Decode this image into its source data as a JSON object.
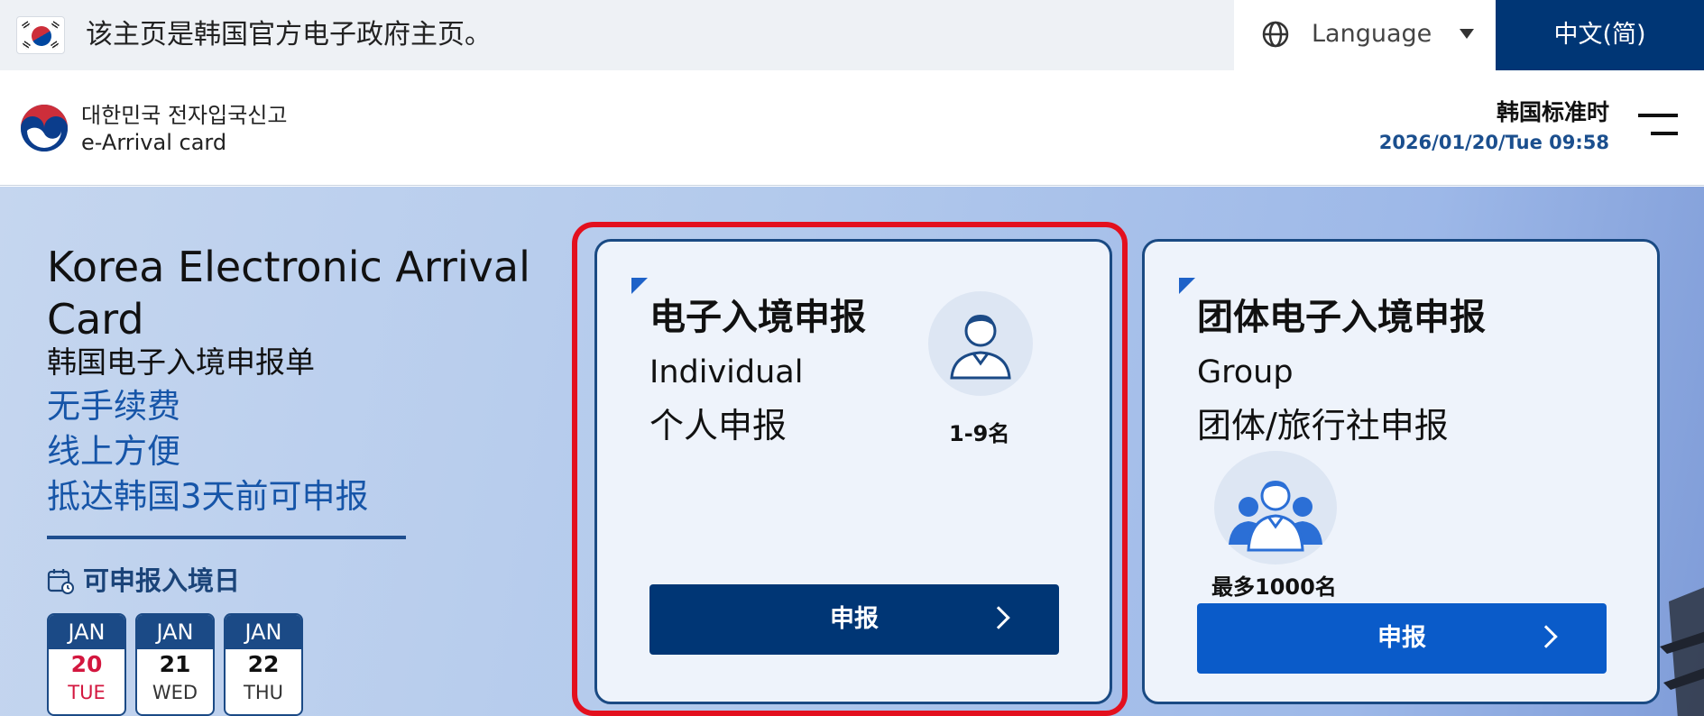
{
  "gov_bar": {
    "notice": "该主页是韩国官方电子政府主页。",
    "language_label": "Language",
    "current_language": "中文(简)"
  },
  "header": {
    "logo_kr": "대한민국 전자입국신고",
    "logo_en": "e-Arrival card",
    "time_label": "韩国标准时",
    "time_value": "2026/01/20/Tue 09:58"
  },
  "hero": {
    "title": "Korea Electronic Arrival Card",
    "subtitle": "韩国电子入境申报单",
    "features": [
      "无手续费",
      "线上方便",
      "抵达韩国3天前可申报"
    ],
    "available_label": "可申报入境日",
    "dates": [
      {
        "month": "JAN",
        "day": "20",
        "weekday": "TUE"
      },
      {
        "month": "JAN",
        "day": "21",
        "weekday": "WED"
      },
      {
        "month": "JAN",
        "day": "22",
        "weekday": "THU"
      }
    ]
  },
  "cards": {
    "individual": {
      "title": "电子入境申报",
      "en": "Individual",
      "cn": "个人申报",
      "capacity": "1-9名",
      "button": "申报"
    },
    "group": {
      "title": "团体电子入境申报",
      "en": "Group",
      "cn": "团体/旅行社申报",
      "capacity": "最多1000名",
      "button": "申报"
    }
  },
  "icons": {
    "flag": "korea-flag-icon",
    "globe": "globe-icon",
    "caret": "caret-down-icon",
    "menu": "hamburger-menu-icon",
    "calendar": "calendar-icon",
    "person": "person-icon",
    "group": "group-icon",
    "chevron": "chevron-right-icon"
  },
  "colors": {
    "navy": "#003675",
    "accent_blue": "#0a5bc9",
    "highlight_red": "#e3101e",
    "today_red": "#d3173f"
  }
}
